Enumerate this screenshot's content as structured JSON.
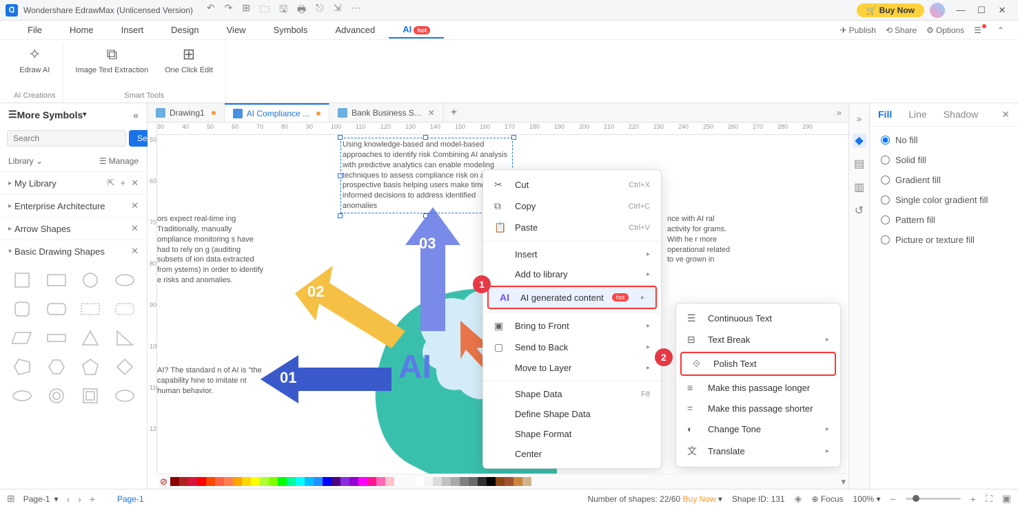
{
  "titlebar": {
    "title": "Wondershare EdrawMax (Unlicensed Version)",
    "buynow": "Buy Now"
  },
  "menubar": {
    "items": [
      "File",
      "Home",
      "Insert",
      "Design",
      "View",
      "Symbols",
      "Advanced",
      "AI"
    ],
    "hot": "hot",
    "publish": "Publish",
    "share": "Share",
    "options": "Options"
  },
  "ribbon": {
    "edraw_ai": "Edraw AI",
    "image_text": "Image Text Extraction",
    "one_click": "One Click Edit",
    "group1": "AI Creations",
    "group2": "Smart Tools"
  },
  "left": {
    "more_symbols": "More Symbols",
    "search_placeholder": "Search",
    "search_btn": "Search",
    "library": "Library",
    "manage": "Manage",
    "mylib": "My Library",
    "ea": "Enterprise Architecture",
    "arrow_shapes": "Arrow Shapes",
    "basic": "Basic Drawing Shapes"
  },
  "tabs": {
    "t1": "Drawing1",
    "t2": "AI Compliance ...",
    "t3": "Bank Business S..."
  },
  "canvas": {
    "text_sel": "Using knowledge-based and model-based approaches to identify risk Combining AI analysis with predictive analytics can enable modeling techniques to assess compliance risk on a prospective basis helping users make timely and informed decisions to address identified anomalies",
    "text_left": "ors expect real-time ing Traditionally, manually ompliance monitoring s have had to rely on g (auditing subsets of ion data extracted from ystems) in order to identify e risks and anomalies.",
    "text_left2": "AI? The standard n of AI is \"the capability hine to imitate nt human behavior.",
    "text_right": "nce with AI ral activity for grams. With he r more operational related to ve grown in",
    "ai_label": "AI",
    "n01": "01",
    "n02": "02",
    "n03": "03"
  },
  "context": {
    "cut": "Cut",
    "cut_k": "Ctrl+X",
    "copy": "Copy",
    "copy_k": "Ctrl+C",
    "paste": "Paste",
    "paste_k": "Ctrl+V",
    "insert": "Insert",
    "addlib": "Add to library",
    "aigen": "AI generated content",
    "hot": "hot",
    "bring": "Bring to Front",
    "send": "Send to Back",
    "layer": "Move to Layer",
    "shapedata": "Shape Data",
    "shapedata_k": "F8",
    "defshape": "Define Shape Data",
    "shapefmt": "Shape Format",
    "center": "Center"
  },
  "submenu": {
    "continuous": "Continuous Text",
    "break": "Text Break",
    "polish": "Polish Text",
    "longer": "Make this passage longer",
    "shorter": "Make this passage shorter",
    "tone": "Change Tone",
    "translate": "Translate"
  },
  "rightpanel": {
    "fill": "Fill",
    "line": "Line",
    "shadow": "Shadow",
    "nofill": "No fill",
    "solid": "Solid fill",
    "gradient": "Gradient fill",
    "single": "Single color gradient fill",
    "pattern": "Pattern fill",
    "picture": "Picture or texture fill"
  },
  "status": {
    "page_sel": "Page-1",
    "page_name": "Page-1",
    "shapes": "Number of shapes: 22/60",
    "buynow": "Buy Now",
    "shapeid": "Shape ID: 131",
    "focus": "Focus",
    "zoom": "100%"
  },
  "callouts": {
    "c1": "1",
    "c2": "2"
  }
}
